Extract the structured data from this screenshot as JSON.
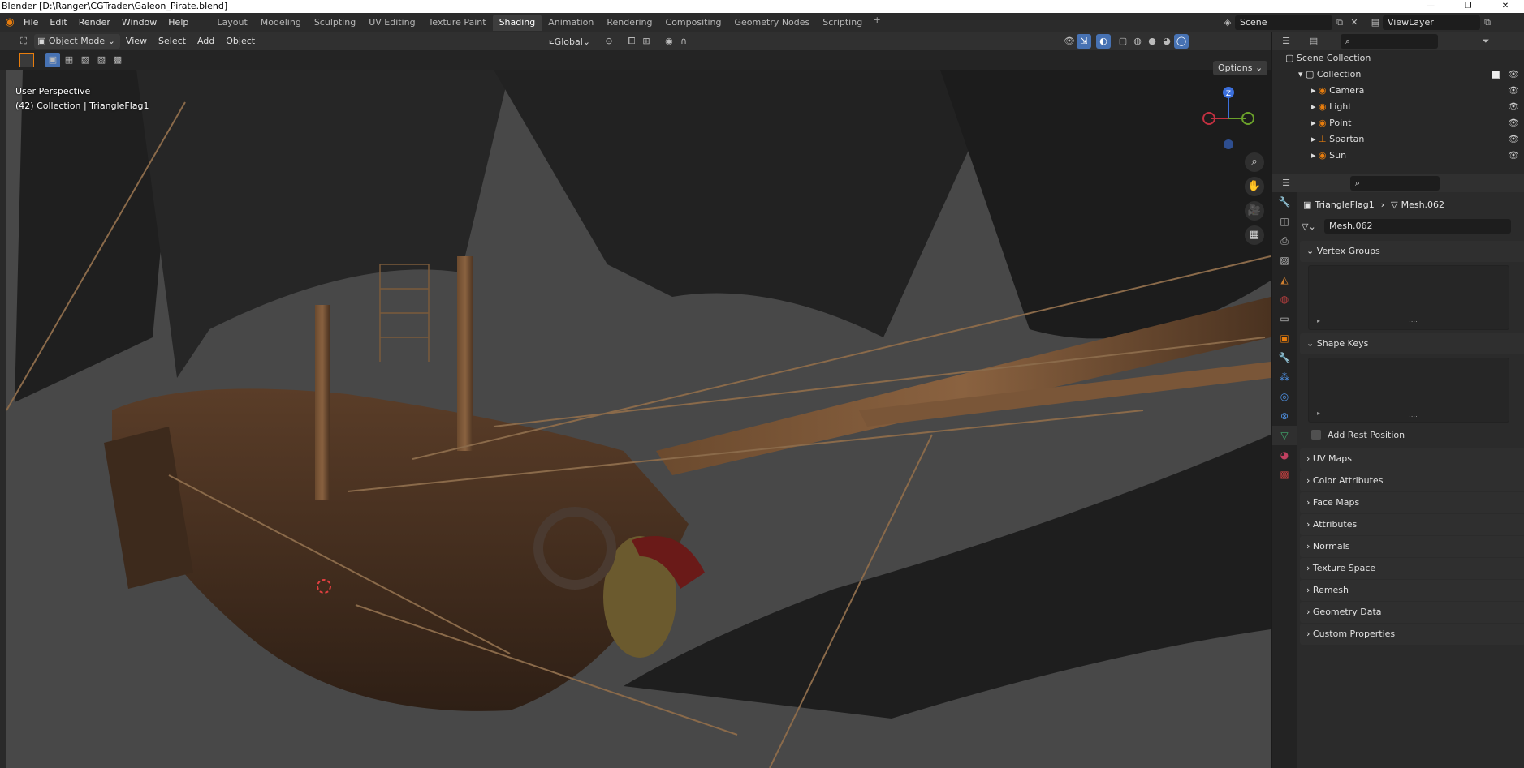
{
  "window": {
    "title": "Blender [D:\\Ranger\\CGTrader\\Galeon_Pirate.blend]"
  },
  "menu": [
    "File",
    "Edit",
    "Render",
    "Window",
    "Help"
  ],
  "workspaces": [
    "Layout",
    "Modeling",
    "Sculpting",
    "UV Editing",
    "Texture Paint",
    "Shading",
    "Animation",
    "Rendering",
    "Compositing",
    "Geometry Nodes",
    "Scripting"
  ],
  "active_workspace": "Shading",
  "scene": {
    "name": "Scene",
    "view_layer": "ViewLayer"
  },
  "viewport_header": {
    "mode": "Object Mode",
    "menus": [
      "View",
      "Select",
      "Add",
      "Object"
    ],
    "orientation": "Global",
    "options_label": "Options"
  },
  "viewport_info": {
    "view": "User Perspective",
    "collection": "(42) Collection | TriangleFlag1"
  },
  "gizmo": {
    "z": "Z"
  },
  "outliner": {
    "root": "Scene Collection",
    "collection": "Collection",
    "items": [
      "Camera",
      "Light",
      "Point",
      "Spartan",
      "Sun"
    ]
  },
  "properties": {
    "object_name": "TriangleFlag1",
    "mesh_name": "Mesh.062",
    "data_field": "Mesh.062",
    "open_panels": [
      "Vertex Groups",
      "Shape Keys"
    ],
    "add_rest_position": "Add Rest Position",
    "collapsed_panels": [
      "UV Maps",
      "Color Attributes",
      "Face Maps",
      "Attributes",
      "Normals",
      "Texture Space",
      "Remesh",
      "Geometry Data",
      "Custom Properties"
    ]
  },
  "colors": {
    "accent": "#4772b3",
    "orange": "#e87d0d",
    "bg": "#1d1d1d"
  }
}
